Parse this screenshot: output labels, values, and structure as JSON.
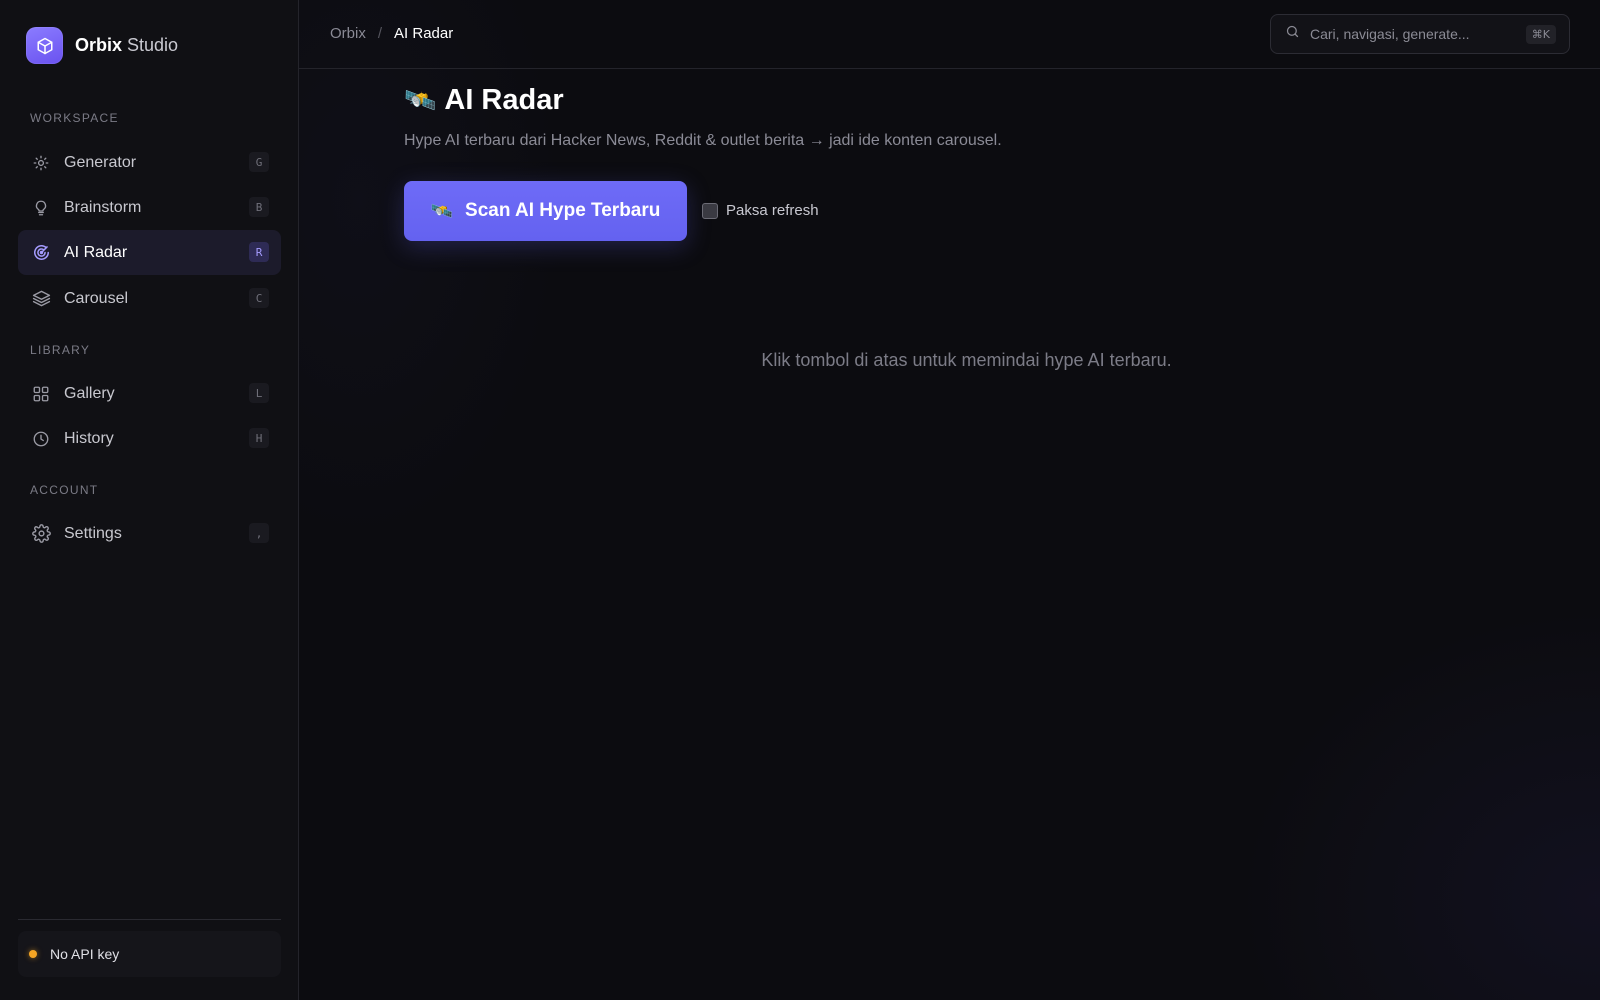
{
  "brand": {
    "name_bold": "Orbix",
    "name_light": "Studio"
  },
  "sidebar": {
    "sections": [
      {
        "label": "WORKSPACE"
      },
      {
        "label": "LIBRARY"
      },
      {
        "label": "ACCOUNT"
      }
    ],
    "items": [
      {
        "label": "Generator",
        "shortcut": "G",
        "icon": "sun-icon"
      },
      {
        "label": "Brainstorm",
        "shortcut": "B",
        "icon": "lightbulb-icon"
      },
      {
        "label": "AI Radar",
        "shortcut": "R",
        "icon": "radar-icon",
        "active": true
      },
      {
        "label": "Carousel",
        "shortcut": "C",
        "icon": "layers-icon"
      },
      {
        "label": "Gallery",
        "shortcut": "L",
        "icon": "grid-icon"
      },
      {
        "label": "History",
        "shortcut": "H",
        "icon": "clock-icon"
      },
      {
        "label": "Settings",
        "shortcut": ",",
        "icon": "gear-icon"
      }
    ],
    "api_status": {
      "label": "No API key",
      "color": "#f5a524"
    }
  },
  "topbar": {
    "breadcrumb": {
      "root": "Orbix",
      "separator": "/",
      "current": "AI Radar"
    },
    "search": {
      "placeholder": "Cari, navigasi, generate...",
      "shortcut": "⌘K"
    }
  },
  "main": {
    "title_icon": "🛰️",
    "title": "AI Radar",
    "subtitle": "Hype AI terbaru dari Hacker News, Reddit & outlet berita → jadi ide konten carousel.",
    "scan_button": {
      "icon": "🛰️",
      "label": "Scan AI Hype Terbaru"
    },
    "force_refresh": {
      "label": "Paksa refresh",
      "checked": false
    },
    "empty_state": "Klik tombol di atas untuk memindai hype AI terbaru."
  },
  "colors": {
    "accent": "#6462f0",
    "brand_logo": "#7b66f5",
    "background": "#0c0c10",
    "sidebar_bg": "#101014",
    "warning": "#f5a524"
  }
}
